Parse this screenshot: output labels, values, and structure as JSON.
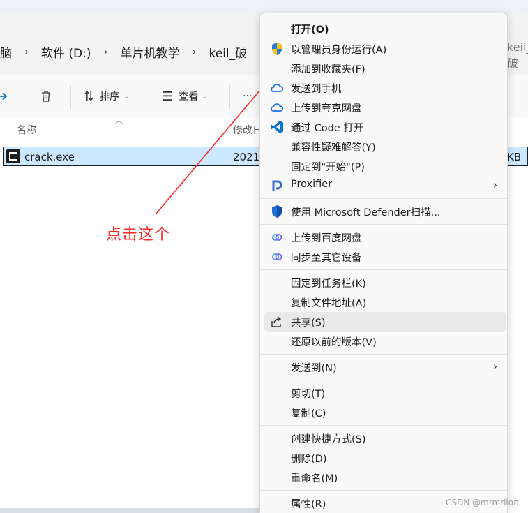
{
  "explorer": {
    "breadcrumbs": [
      "脑",
      "软件 (D:)",
      "单片机教学",
      "keil_破"
    ],
    "breadcrumb_right": "keil_破",
    "commands": {
      "sort": "排序",
      "view": "查看",
      "more": "···"
    },
    "columns": {
      "name": "名称",
      "date": "修改日"
    },
    "file": {
      "name": "crack.exe",
      "date": "2021,",
      "size": "KB"
    }
  },
  "annotation": {
    "text": "点击这个",
    "color": "#ff2a2a"
  },
  "context_menu": {
    "items": [
      {
        "label": "打开(O)",
        "bold": true,
        "icon": ""
      },
      {
        "label": "以管理员身份运行(A)",
        "icon": "uac-shield-icon"
      },
      {
        "label": "添加到收藏夹(F)",
        "icon": ""
      },
      {
        "label": "发送到手机",
        "icon": "cloud-icon"
      },
      {
        "label": "上传到夸克网盘",
        "icon": "cloud-icon"
      },
      {
        "label": "通过 Code 打开",
        "icon": "vscode-icon"
      },
      {
        "label": "兼容性疑难解答(Y)",
        "icon": ""
      },
      {
        "label": "固定到\"开始\"(P)",
        "icon": ""
      },
      {
        "label": "Proxifier",
        "icon": "proxifier-icon",
        "submenu": "›"
      },
      {
        "label": "使用 Microsoft Defender扫描...",
        "icon": "defender-shield-icon"
      },
      {
        "label": "上传到百度网盘",
        "icon": "baidu-cloud-icon"
      },
      {
        "label": "同步至其它设备",
        "icon": "baidu-cloud-icon"
      },
      {
        "label": "固定到任务栏(K)",
        "icon": ""
      },
      {
        "label": "复制文件地址(A)",
        "icon": ""
      },
      {
        "label": "共享(S)",
        "icon": "share-icon",
        "hover": true
      },
      {
        "label": "还原以前的版本(V)",
        "icon": ""
      },
      {
        "label": "发送到(N)",
        "icon": "",
        "submenu": "›"
      },
      {
        "label": "剪切(T)",
        "icon": ""
      },
      {
        "label": "复制(C)",
        "icon": ""
      },
      {
        "label": "创建快捷方式(S)",
        "icon": ""
      },
      {
        "label": "删除(D)",
        "icon": ""
      },
      {
        "label": "重命名(M)",
        "icon": ""
      },
      {
        "label": "属性(R)",
        "icon": ""
      }
    ]
  },
  "watermark": "CSDN @mrmrlion",
  "colors": {
    "selection": "#cce8ff",
    "menu_bg": "#f9f9f9",
    "accent": "#0067c0",
    "arrow": "#ff2a2a"
  }
}
